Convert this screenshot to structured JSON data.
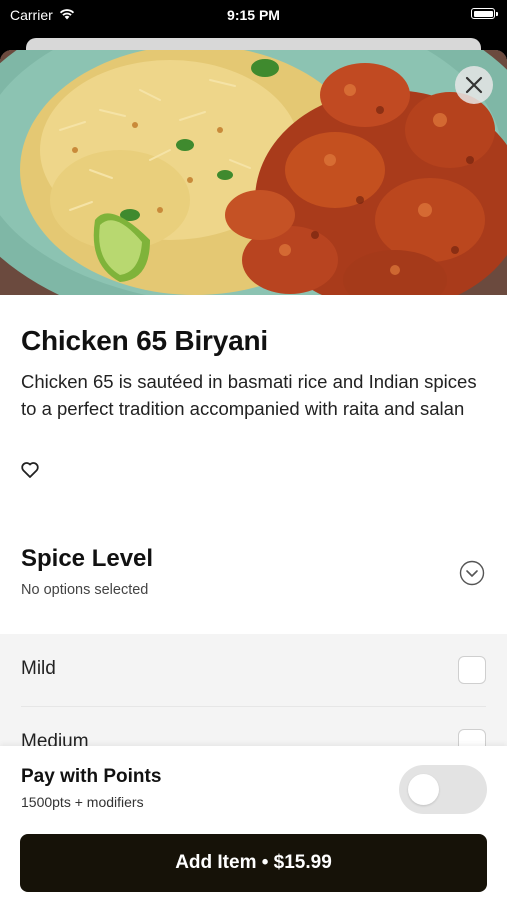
{
  "status_bar": {
    "carrier": "Carrier",
    "time": "9:15 PM"
  },
  "item": {
    "name": "Chicken 65 Biryani",
    "description": "Chicken 65 is sautéed in basmati rice and Indian spices to a perfect tradition accompanied with raita and salan"
  },
  "spice_level": {
    "title": "Spice Level",
    "subtitle": "No options selected",
    "options": [
      {
        "label": "Mild",
        "checked": false
      },
      {
        "label": "Medium",
        "checked": false
      }
    ]
  },
  "pay_with_points": {
    "title": "Pay with Points",
    "subtitle": "1500pts + modifiers",
    "enabled": false
  },
  "add_button": {
    "label": "Add Item • $15.99"
  },
  "colors": {
    "primary_button": "#161208",
    "options_background": "#f4f4f4",
    "toggle_off": "#e3e3e3"
  }
}
